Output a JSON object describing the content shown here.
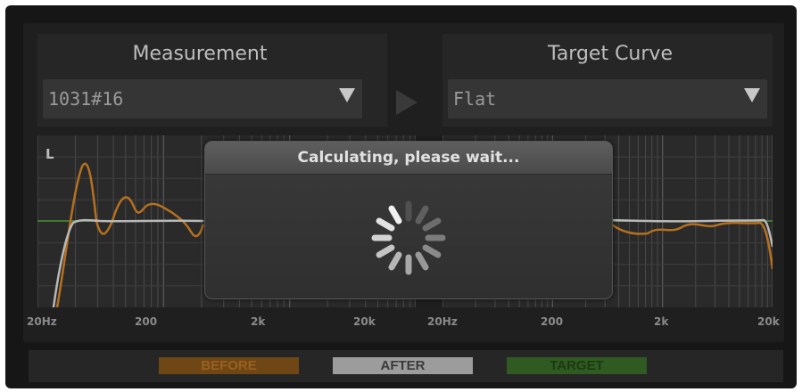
{
  "measurement": {
    "title": "Measurement",
    "selected": "1031#16"
  },
  "target_curve": {
    "title": "Target Curve",
    "selected": "Flat"
  },
  "graph": {
    "channel_label": "L"
  },
  "freq_labels_left": [
    "20Hz",
    "200",
    "2k",
    "20k"
  ],
  "freq_labels_right": [
    "20Hz",
    "200",
    "2k",
    "20k"
  ],
  "legend": {
    "before": "BEFORE",
    "after": "AFTER",
    "target": "TARGET"
  },
  "colors": {
    "before": "#b5701f",
    "after": "#b8b8b8",
    "target": "#3f7a2e"
  },
  "modal": {
    "title": "Calculating, please wait..."
  },
  "icons": {
    "spinner": "loading-spinner-icon",
    "dropdown": "triangle-down-icon",
    "play": "play-icon"
  }
}
